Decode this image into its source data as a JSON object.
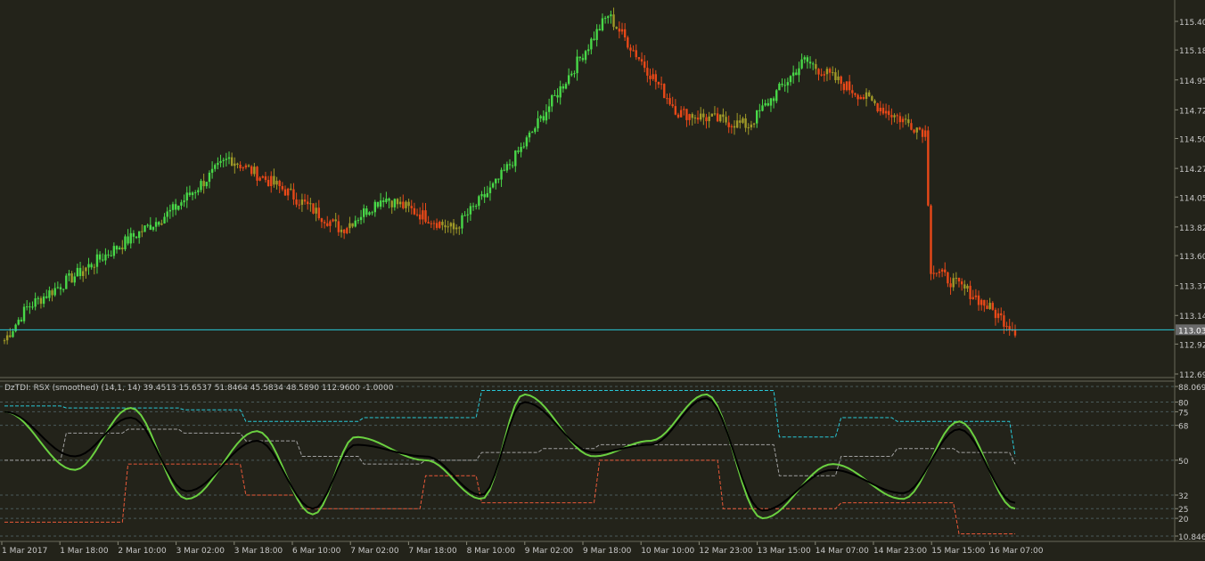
{
  "main_chart": {
    "price_labels": [
      "115.40",
      "115.18",
      "114.95",
      "114.72",
      "114.50",
      "114.27",
      "114.05",
      "113.82",
      "113.60",
      "113.37",
      "113.14",
      "112.92",
      "112.69"
    ],
    "current_price": "113.03",
    "current_price_line_color": "#28c8d8",
    "candle_colors": [
      "#48d848",
      "#a09a28",
      "#e84818"
    ]
  },
  "indicator": {
    "caption": "DzTDI:  RSX (smoothed) (14,1, 14) 39.4513 15.6537 51.8464 45.5834 48.5890 112.9600 -1.0000",
    "level_labels": [
      "88.0695",
      "80",
      "75",
      "68",
      "50",
      "32",
      "25",
      "20",
      "10.8461"
    ]
  },
  "time_axis": {
    "labels": [
      "1 Mar 2017",
      "1 Mar 18:00",
      "2 Mar 10:00",
      "3 Mar 02:00",
      "3 Mar 18:00",
      "6 Mar 10:00",
      "7 Mar 02:00",
      "7 Mar 18:00",
      "8 Mar 10:00",
      "9 Mar 02:00",
      "9 Mar 18:00",
      "10 Mar 10:00",
      "12 Mar 23:00",
      "13 Mar 15:00",
      "14 Mar 07:00",
      "14 Mar 23:00",
      "15 Mar 15:00",
      "16 Mar 07:00"
    ]
  },
  "chart_data": [
    {
      "type": "candlestick",
      "title": "",
      "ylim": [
        112.69,
        115.4
      ],
      "key_prices": [
        {
          "x": 0,
          "close": 112.95
        },
        {
          "x": 8,
          "close": 113.2
        },
        {
          "x": 60,
          "close": 113.95
        },
        {
          "x": 80,
          "close": 114.35
        },
        {
          "x": 100,
          "close": 114.1
        },
        {
          "x": 120,
          "close": 113.8
        },
        {
          "x": 135,
          "close": 114.05
        },
        {
          "x": 160,
          "close": 113.8
        },
        {
          "x": 175,
          "close": 114.15
        },
        {
          "x": 185,
          "close": 114.45
        },
        {
          "x": 215,
          "close": 115.45
        },
        {
          "x": 240,
          "close": 114.7
        },
        {
          "x": 265,
          "close": 114.6
        },
        {
          "x": 285,
          "close": 115.1
        },
        {
          "x": 315,
          "close": 114.7
        },
        {
          "x": 328,
          "close": 114.55
        },
        {
          "x": 330,
          "close": 113.5
        },
        {
          "x": 345,
          "close": 113.3
        },
        {
          "x": 360,
          "close": 113.03
        }
      ],
      "current_price": 113.03
    },
    {
      "type": "line",
      "title": "DzTDI",
      "ylim": [
        10.8461,
        88.0695
      ],
      "levels": [
        88.0695,
        80,
        75,
        68,
        50,
        32,
        25,
        20,
        10.8461
      ],
      "series": [
        {
          "name": "RSX",
          "x": [
            0,
            25,
            45,
            65,
            90,
            110,
            125,
            150,
            170,
            185,
            210,
            230,
            250,
            270,
            295,
            320,
            340,
            360
          ],
          "values": [
            75,
            45,
            77,
            30,
            65,
            22,
            62,
            50,
            30,
            84,
            52,
            60,
            84,
            20,
            48,
            30,
            70,
            25
          ]
        },
        {
          "name": "",
          "x": [
            0,
            25,
            45,
            65,
            90,
            110,
            125,
            150,
            170,
            185,
            210,
            230,
            250,
            270,
            295,
            320,
            340,
            360
          ],
          "values": [
            75,
            52,
            72,
            34,
            60,
            25,
            58,
            52,
            32,
            80,
            54,
            58,
            82,
            24,
            45,
            33,
            66,
            28
          ]
        }
      ]
    }
  ]
}
